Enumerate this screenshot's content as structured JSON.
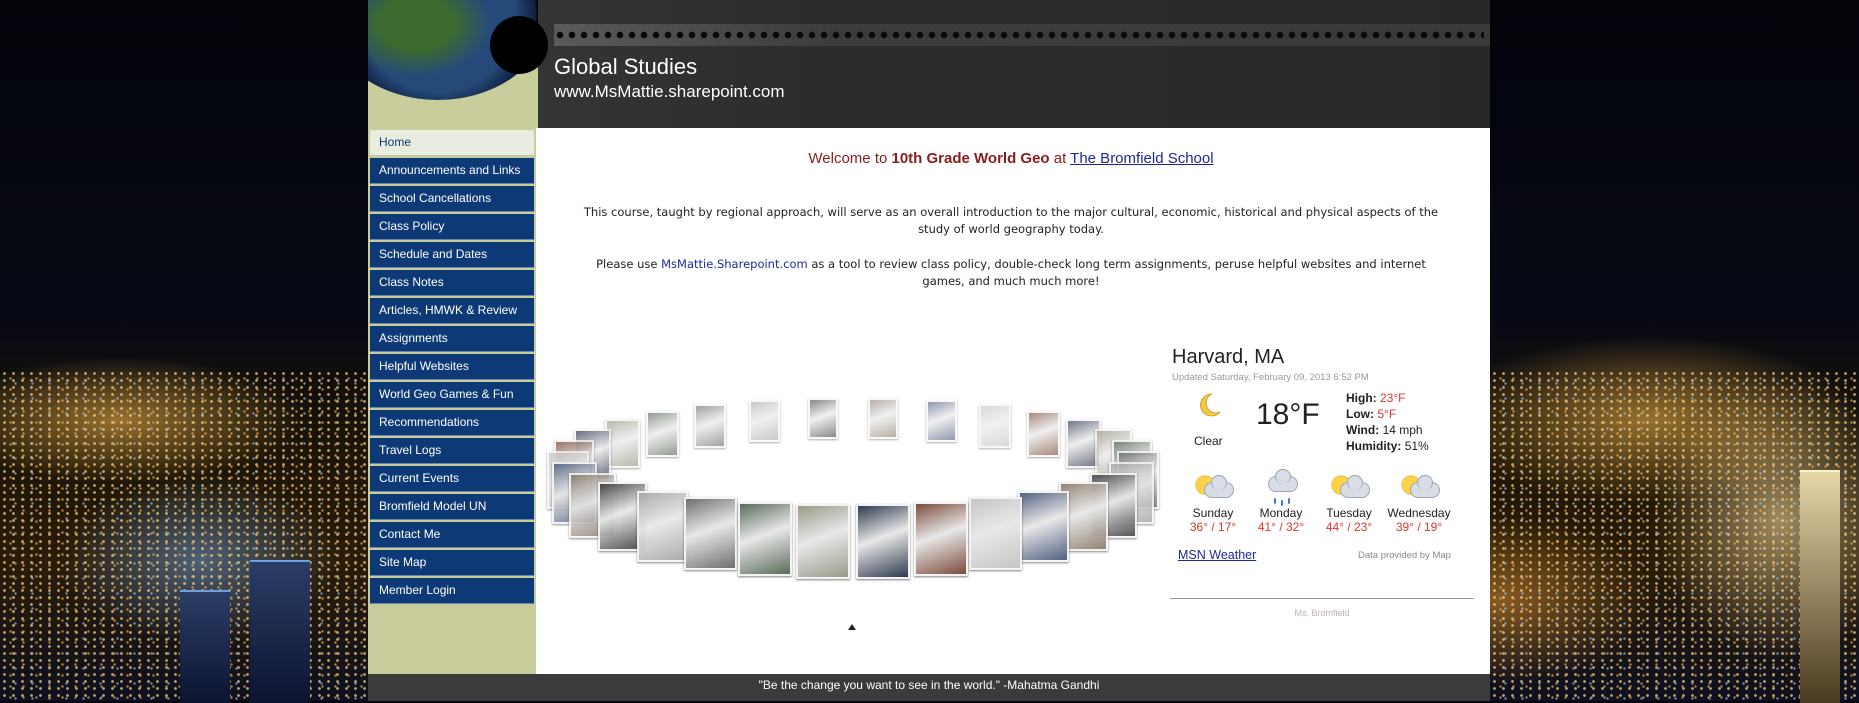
{
  "header": {
    "title": "Global Studies",
    "url": "www.MsMattie.sharepoint.com"
  },
  "sidebar": {
    "items": [
      {
        "label": "Home",
        "active": true
      },
      {
        "label": "Announcements and Links"
      },
      {
        "label": "School Cancellations"
      },
      {
        "label": "Class Policy"
      },
      {
        "label": "Schedule and Dates"
      },
      {
        "label": "Class Notes"
      },
      {
        "label": "Articles, HMWK & Review"
      },
      {
        "label": "Assignments"
      },
      {
        "label": "Helpful Websites"
      },
      {
        "label": "World Geo Games & Fun"
      },
      {
        "label": "Recommendations"
      },
      {
        "label": "Travel Logs"
      },
      {
        "label": "Current Events"
      },
      {
        "label": "Bromfield Model UN"
      },
      {
        "label": "Contact Me"
      },
      {
        "label": "Site Map"
      },
      {
        "label": "Member Login"
      }
    ]
  },
  "main": {
    "welcome_prefix": "Welcome to ",
    "welcome_bold": "10th Grade World Geo",
    "welcome_mid": " at ",
    "welcome_link": "The Bromfield School",
    "para1": "This course, taught by regional approach, will serve as an overall introduction to the major cultural, economic, historical and physical aspects of the study of world geography today.",
    "para2_prefix": "Please use ",
    "para2_link": "MsMattie.Sharepoint.com",
    "para2_suffix": " as a tool to review class policy, double-check long term assignments,  peruse helpful websites and internet games, and much much more!"
  },
  "weather": {
    "city": "Harvard, MA",
    "updated": "Updated Saturday, February 09, 2013 6:52 PM",
    "temp": "18°F",
    "condition": "Clear",
    "high_label": "High:",
    "high": "23°F",
    "low_label": "Low:",
    "low": "5°F",
    "wind_label": "Wind:",
    "wind": "14 mph",
    "humidity_label": "Humidity:",
    "humidity": "51%",
    "forecast": [
      {
        "day": "Sunday",
        "range": "36° / 17°",
        "icon": "partly-sunny-icon"
      },
      {
        "day": "Monday",
        "range": "41° / 32°",
        "icon": "rain-icon"
      },
      {
        "day": "Tuesday",
        "range": "44° / 23°",
        "icon": "partly-sunny-icon"
      },
      {
        "day": "Wednesday",
        "range": "39° / 19°",
        "icon": "partly-sunny-icon"
      }
    ],
    "source_link": "MSN Weather",
    "provider": "Data provided by Map",
    "faint_text": "Ms. Bromfield"
  },
  "footer": {
    "quote": "\"Be the change you want to see in the world.\" -Mahatma Gandhi"
  },
  "colors": {
    "nav_bg": "#0d3a76",
    "sidebar_bg": "#c9cc9b",
    "header_bg": "#2c2c2c",
    "link": "#1b2a9a",
    "welcome": "#8a1c1c",
    "temp_red": "#e0352b"
  }
}
